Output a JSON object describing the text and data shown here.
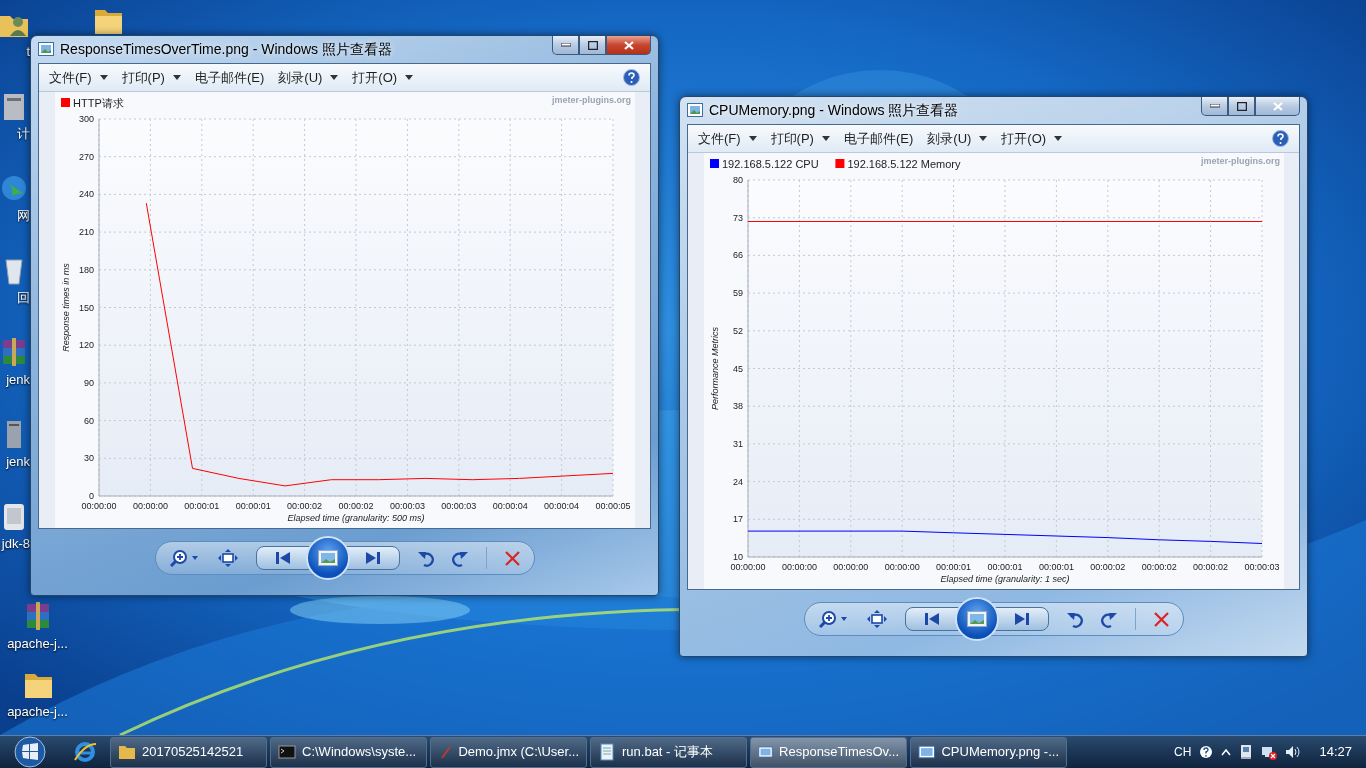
{
  "desktop": {
    "covered_icons": [
      {
        "kind": "user-folder",
        "label": "t"
      },
      {
        "kind": "computer",
        "label": "计"
      },
      {
        "kind": "network",
        "label": "网"
      },
      {
        "kind": "recycle",
        "label": "回"
      },
      {
        "kind": "archive",
        "label": "jenk"
      },
      {
        "kind": "server",
        "label": "jenk"
      },
      {
        "kind": "app",
        "label": "jdk-8"
      }
    ],
    "icons": [
      {
        "kind": "archive",
        "label": "apache-j..."
      },
      {
        "kind": "folder",
        "label": "apache-j..."
      }
    ],
    "second_column_icons": [
      {
        "kind": "folder"
      }
    ]
  },
  "windows": [
    {
      "title": "ResponseTimesOverTime.png - Windows 照片查看器",
      "active": true,
      "menu": [
        {
          "label": "文件(F)",
          "dropdown": true
        },
        {
          "label": "打印(P)",
          "dropdown": true
        },
        {
          "label": "电子邮件(E)",
          "dropdown": false
        },
        {
          "label": "刻录(U)",
          "dropdown": true
        },
        {
          "label": "打开(O)",
          "dropdown": true
        }
      ],
      "image_credit": "jmeter-plugins.org",
      "chart_data": {
        "type": "line",
        "xlabel": "Elapsed time (granularity: 500 ms)",
        "ylabel": "Response times in ms",
        "x": [
          0.46,
          0.91,
          1.36,
          1.81,
          2.26,
          2.72,
          3.18,
          3.63,
          4.09,
          4.54,
          5.0
        ],
        "series": [
          {
            "name": "HTTP请求",
            "color": "#ff0000",
            "values": [
              233,
              22,
              14,
              8,
              13,
              13,
              14,
              13,
              14,
              16,
              18
            ]
          }
        ],
        "xlim": [
          0,
          5
        ],
        "ylim": [
          0,
          300
        ],
        "xticks": [
          {
            "value": 0,
            "label": "00:00:00"
          },
          {
            "value": 0.5,
            "label": "00:00:00"
          },
          {
            "value": 1,
            "label": "00:00:01"
          },
          {
            "value": 1.5,
            "label": "00:00:01"
          },
          {
            "value": 2,
            "label": "00:00:02"
          },
          {
            "value": 2.5,
            "label": "00:00:02"
          },
          {
            "value": 3,
            "label": "00:00:03"
          },
          {
            "value": 3.5,
            "label": "00:00:03"
          },
          {
            "value": 4,
            "label": "00:00:04"
          },
          {
            "value": 4.5,
            "label": "00:00:04"
          },
          {
            "value": 5,
            "label": "00:00:05"
          }
        ],
        "yticks": [
          0,
          30,
          60,
          90,
          120,
          150,
          180,
          210,
          240,
          270,
          300
        ],
        "grid": true,
        "legend": "top left"
      }
    },
    {
      "title": "CPUMemory.png - Windows 照片查看器",
      "active": false,
      "menu": [
        {
          "label": "文件(F)",
          "dropdown": true
        },
        {
          "label": "打印(P)",
          "dropdown": true
        },
        {
          "label": "电子邮件(E)",
          "dropdown": false
        },
        {
          "label": "刻录(U)",
          "dropdown": true
        },
        {
          "label": "打开(O)",
          "dropdown": true
        }
      ],
      "image_credit": "jmeter-plugins.org",
      "chart_data": {
        "type": "line",
        "xlabel": "Elapsed time (granularity: 1 sec)",
        "ylabel": "Performance Metrics",
        "x": [
          -0.45,
          0.45,
          0.75,
          1.05,
          1.35,
          1.65,
          1.95,
          2.25,
          2.55
        ],
        "series": [
          {
            "name": "192.168.5.122 CPU",
            "color": "#0000ff",
            "values": [
              14.8,
              14.8,
              14.5,
              14.2,
              13.9,
              13.6,
              13.2,
              12.9,
              12.5
            ]
          },
          {
            "name": "192.168.5.122 Memory",
            "color": "#ff0000",
            "values": [
              72.3,
              72.3,
              72.3,
              72.3,
              72.3,
              72.3,
              72.3,
              72.3,
              72.3
            ]
          }
        ],
        "xlim": [
          -0.45,
          2.55
        ],
        "ylim": [
          10,
          80
        ],
        "xticks": [
          {
            "value": -0.45,
            "label": "00:00:00"
          },
          {
            "value": -0.15,
            "label": "00:00:00"
          },
          {
            "value": 0.15,
            "label": "00:00:00"
          },
          {
            "value": 0.45,
            "label": "00:00:00"
          },
          {
            "value": 0.75,
            "label": "00:00:01"
          },
          {
            "value": 1.05,
            "label": "00:00:01"
          },
          {
            "value": 1.35,
            "label": "00:00:01"
          },
          {
            "value": 1.65,
            "label": "00:00:02"
          },
          {
            "value": 1.95,
            "label": "00:00:02"
          },
          {
            "value": 2.25,
            "label": "00:00:02"
          },
          {
            "value": 2.55,
            "label": "00:00:03"
          }
        ],
        "yticks": [
          10,
          17,
          24,
          31,
          38,
          45,
          52,
          59,
          66,
          73,
          80
        ],
        "grid": true,
        "legend": "top left"
      }
    }
  ],
  "taskbar": {
    "tasks": [
      {
        "kind": "folder",
        "label": "20170525142521",
        "selected": false
      },
      {
        "kind": "console",
        "label": "C:\\Windows\\syste...",
        "selected": false
      },
      {
        "kind": "editor",
        "label": "Demo.jmx (C:\\User...",
        "selected": false
      },
      {
        "kind": "notepad",
        "label": "run.bat - 记事本",
        "selected": false
      },
      {
        "kind": "viewer",
        "label": "ResponseTimesOv...",
        "selected": true
      },
      {
        "kind": "viewer",
        "label": "CPUMemory.png -...",
        "selected": false
      }
    ],
    "language": "CH",
    "clock": "14:27"
  }
}
